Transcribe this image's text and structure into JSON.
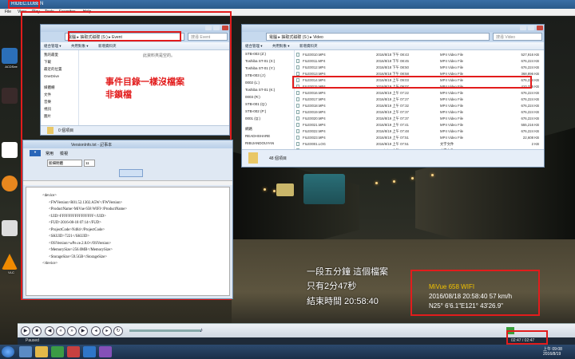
{
  "player": {
    "title": "RIDEC.LUBEN",
    "menu": [
      "File",
      "View",
      "Play",
      "Tools",
      "Favorites",
      "Help"
    ],
    "status": "Paused",
    "time": "02:47 / 02:47",
    "osd": {
      "brand": "MiVue 658 WIFI",
      "datetime": "2016/08/18 20:58:40   57 km/h",
      "coords": "N25° 6'6.1\"E121° 43'26.9\""
    }
  },
  "annotations": {
    "line1": "事件目錄一樣沒檔案",
    "line2": "非鎖檔",
    "sub1": "一段五分鐘 這個檔案",
    "sub2": "只有2分47秒",
    "sub3": "結束時間 20:58:40"
  },
  "explorer_event": {
    "address": [
      "電腦",
      "抽取式磁碟 (S:)",
      "Event"
    ],
    "search": "搜尋 Event",
    "tools": [
      "組合管理 ▾",
      "共用對象 ▾",
      "新增資料夾"
    ],
    "nav": [
      "我的最愛",
      "下載",
      "最近的位置",
      "OneDrive",
      "媒體櫃",
      "文件",
      "音樂",
      "視訊",
      "圖片"
    ],
    "empty": "此資料夾是空的。",
    "status": "0 個項目"
  },
  "explorer_video": {
    "address": [
      "電腦",
      "抽取式磁碟 (S:)",
      "Video"
    ],
    "search": "搜尋 Video",
    "tools": [
      "組合管理 ▾",
      "共用對象 ▾",
      "新增資料夾"
    ],
    "nav": [
      "STB-003 (Z:)",
      "Toshiba ST-01 (X:)",
      "Toshiba ST-01 (Y:)",
      "STB-003 (J:)",
      "0002 (L:)",
      "Toshiba ST-01 (K:)",
      "0003 (R:)",
      "STB-001 (Q:)",
      "STB-002 (P:)",
      "0001 (Q:)",
      "網路",
      "READHSHARE",
      "RIBIJANDOUYAN"
    ],
    "files": [
      {
        "name": "FILE0010.MP4",
        "date": "2016/8/18 下午 08:43",
        "type": "MP4 Video File",
        "size": "527,916 KB"
      },
      {
        "name": "FILE0011.MP4",
        "date": "2016/8/18 下午 08:45",
        "type": "MP4 Video File",
        "size": "676,224 KB"
      },
      {
        "name": "FILE0012.MP4",
        "date": "2016/8/18 下午 08:50",
        "type": "MP4 Video File",
        "size": "676,224 KB"
      },
      {
        "name": "FILE0013.MP4",
        "date": "2016/8/18 下午 08:58",
        "type": "MP4 Video File",
        "size": "368,896 KB"
      },
      {
        "name": "FILE0014.MP4",
        "date": "2016/8/19 上午 09:03",
        "type": "MP4 Video File",
        "size": "676,224 KB"
      },
      {
        "name": "FILE0015.MP4",
        "date": "2016/8/19 上午 09:07",
        "type": "MP4 Video File",
        "size": "410,336 KB"
      },
      {
        "name": "FILE0016.MP4",
        "date": "2016/8/19 上午 07:22",
        "type": "MP4 Video File",
        "size": "676,224 KB"
      },
      {
        "name": "FILE0017.MP4",
        "date": "2016/8/19 上午 07:27",
        "type": "MP4 Video File",
        "size": "676,224 KB"
      },
      {
        "name": "FILE0018.MP4",
        "date": "2016/8/19 上午 07:32",
        "type": "MP4 Video File",
        "size": "676,224 KB"
      },
      {
        "name": "FILE0019.MP4",
        "date": "2016/8/19 上午 07:37",
        "type": "MP4 Video File",
        "size": "676,224 KB"
      },
      {
        "name": "FILE0020.MP4",
        "date": "2016/8/19 上午 07:37",
        "type": "MP4 Video File",
        "size": "676,224 KB"
      },
      {
        "name": "FILE0021.MP4",
        "date": "2016/8/19 上午 07:41",
        "type": "MP4 Video File",
        "size": "555,216 KB"
      },
      {
        "name": "FILE0022.MP4",
        "date": "2016/8/19 上午 07:48",
        "type": "MP4 Video File",
        "size": "676,224 KB"
      },
      {
        "name": "FILE0023.MP4",
        "date": "2016/8/19 上午 07:51",
        "type": "MP4 Video File",
        "size": "22,608 KB"
      },
      {
        "name": "FILE0001.LOG",
        "date": "2016/8/19 上午 07:51",
        "type": "文字文件",
        "size": "2 KB"
      },
      {
        "name": "FILE0002.LOG",
        "date": "2016/8/19 上午 07:51",
        "type": "文字文件",
        "size": "2 KB"
      }
    ],
    "status": "48 個項目"
  },
  "notepad": {
    "title": "VersionInfo.txt - 記事本",
    "tabs": [
      "常用",
      "檢視"
    ],
    "font": "新細明體",
    "size": "11",
    "lines": [
      "<device>",
      "<FWVersion>R01.52.1302.A5W</FWVersion>",
      "<ProductName>MiVue 658 WIFI</ProductName>",
      "<UID>FFFFFFFFFFFFFFFF</UID>",
      "<FUD>2016-08-18 07:14</FUD>",
      "<ProjectCode>N484</ProjectCode>",
      "<SKUID>7221</SKUID>",
      "<OSVersion>wPe.ce.2.8.0</OSVersion>",
      "<MemorySize>256.0MB</MemorySize>",
      "<StorageSize>59.5GB</StorageSize>",
      "</device>"
    ]
  },
  "taskbar": {
    "time": "上午 09:08",
    "date": "2016/8/19"
  },
  "desktop": [
    "ACDSee",
    "Zenit",
    "Hoo",
    "運算",
    "ca",
    "Biblog",
    "Bandicam",
    "VLC"
  ]
}
